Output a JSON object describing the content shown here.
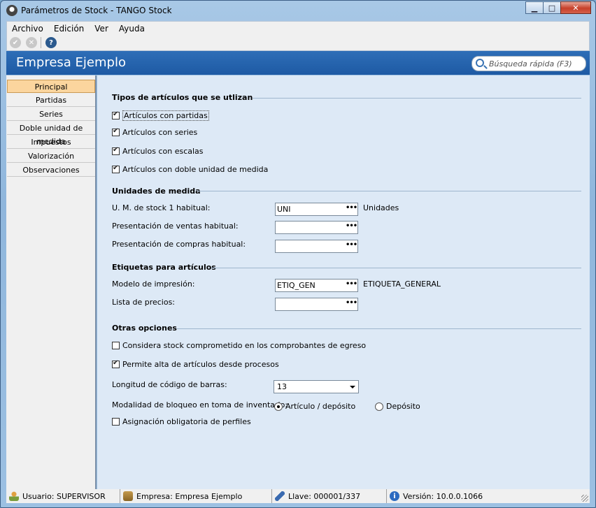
{
  "window": {
    "title": "Parámetros de Stock - TANGO Stock",
    "min_label": "▁",
    "max_label": "□",
    "close_label": "✕"
  },
  "menu": {
    "items": [
      {
        "label": "Archivo"
      },
      {
        "label": "Edición"
      },
      {
        "label": "Ver"
      },
      {
        "label": "Ayuda"
      }
    ]
  },
  "toolbar": {
    "help_glyph": "?"
  },
  "header": {
    "title": "Empresa Ejemplo",
    "search_placeholder": "Búsqueda rápida (F3)"
  },
  "sidebar": {
    "items": [
      {
        "label": "Principal",
        "active": true
      },
      {
        "label": "Partidas"
      },
      {
        "label": "Series"
      },
      {
        "label": "Doble unidad de medida"
      },
      {
        "label": "Impuestos"
      },
      {
        "label": "Valorización"
      },
      {
        "label": "Observaciones"
      }
    ]
  },
  "sections": {
    "tipos": {
      "title": "Tipos de artículos que se utlizan",
      "checks": [
        {
          "label": "Artículos con partidas",
          "checked": true
        },
        {
          "label": "Artículos con series",
          "checked": true
        },
        {
          "label": "Artículos con escalas",
          "checked": true
        },
        {
          "label": "Artículos con doble unidad de medida",
          "checked": true
        }
      ]
    },
    "unidades": {
      "title": "Unidades de medida",
      "fields": [
        {
          "label": "U. M. de stock 1 habitual:",
          "value": "UNI",
          "desc": "Unidades"
        },
        {
          "label": "Presentación de ventas habitual:",
          "value": "",
          "desc": ""
        },
        {
          "label": "Presentación de compras habitual:",
          "value": "",
          "desc": ""
        }
      ]
    },
    "etiquetas": {
      "title": "Etiquetas para artículos",
      "fields": [
        {
          "label": "Modelo de impresión:",
          "value": "ETIQ_GEN",
          "desc": "ETIQUETA_GENERAL"
        },
        {
          "label": "Lista de precios:",
          "value": "",
          "desc": ""
        }
      ]
    },
    "otras": {
      "title": "Otras opciones",
      "check1": {
        "label": "Considera stock comprometido en los comprobantes de egreso",
        "checked": false
      },
      "check2": {
        "label": "Permite alta de artículos desde procesos",
        "checked": true
      },
      "barcode": {
        "label": "Longitud de código de barras:",
        "value": "13"
      },
      "bloqueo": {
        "label": "Modalidad de bloqueo en toma de inventario:",
        "options": [
          {
            "label": "Artículo / depósito",
            "selected": true
          },
          {
            "label": "Depósito",
            "selected": false
          }
        ]
      },
      "check3": {
        "label": "Asignación obligatoria de perfiles",
        "checked": false
      }
    }
  },
  "status": {
    "user": "Usuario: SUPERVISOR",
    "company": "Empresa: Empresa Ejemplo",
    "key": "Llave: 000001/337",
    "version": "Versión: 10.0.0.1066",
    "info_glyph": "i"
  },
  "dots": "•••"
}
